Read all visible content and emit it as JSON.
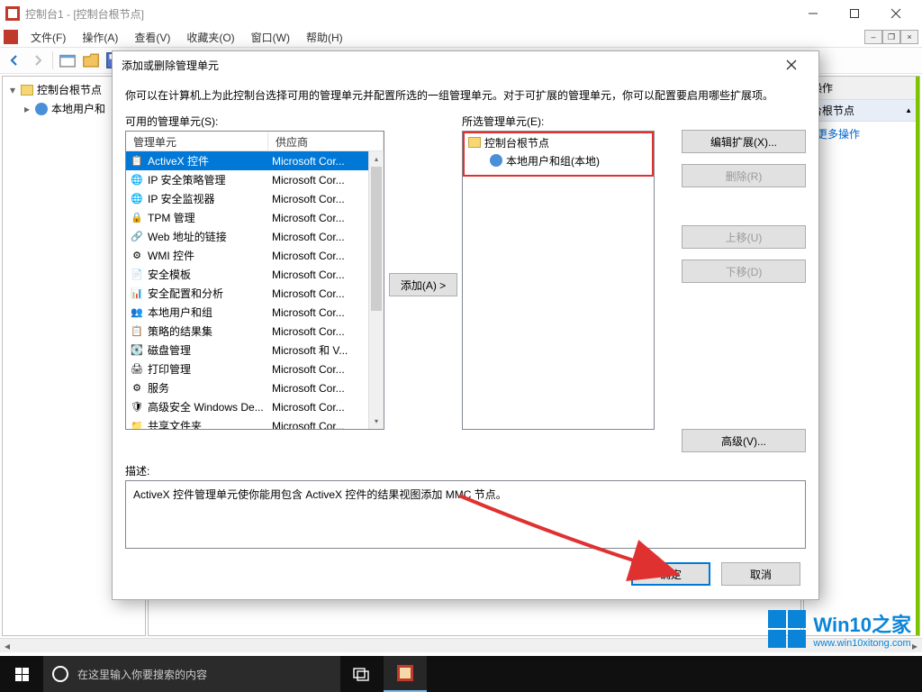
{
  "main_window": {
    "title": "控制台1 - [控制台根节点]",
    "menu": [
      "文件(F)",
      "操作(A)",
      "查看(V)",
      "收藏夹(O)",
      "窗口(W)",
      "帮助(H)"
    ],
    "tree": {
      "root": "控制台根节点",
      "child": "本地用户和"
    },
    "actions_pane": {
      "header": "操作",
      "section": "台根节点",
      "more": "更多操作"
    }
  },
  "dialog": {
    "title": "添加或删除管理单元",
    "intro": "你可以在计算机上为此控制台选择可用的管理单元并配置所选的一组管理单元。对于可扩展的管理单元，你可以配置要启用哪些扩展项。",
    "available_label": "可用的管理单元(S):",
    "selected_label": "所选管理单元(E):",
    "columns": {
      "snapin": "管理单元",
      "vendor": "供应商"
    },
    "available": [
      {
        "name": "ActiveX 控件",
        "vendor": "Microsoft Cor...",
        "icon": "📋",
        "selected": true
      },
      {
        "name": "IP 安全策略管理",
        "vendor": "Microsoft Cor...",
        "icon": "🌐"
      },
      {
        "name": "IP 安全监视器",
        "vendor": "Microsoft Cor...",
        "icon": "🌐"
      },
      {
        "name": "TPM 管理",
        "vendor": "Microsoft Cor...",
        "icon": "🔒"
      },
      {
        "name": "Web 地址的链接",
        "vendor": "Microsoft Cor...",
        "icon": "🔗"
      },
      {
        "name": "WMI 控件",
        "vendor": "Microsoft Cor...",
        "icon": "⚙"
      },
      {
        "name": "安全模板",
        "vendor": "Microsoft Cor...",
        "icon": "📄"
      },
      {
        "name": "安全配置和分析",
        "vendor": "Microsoft Cor...",
        "icon": "📊"
      },
      {
        "name": "本地用户和组",
        "vendor": "Microsoft Cor...",
        "icon": "👥"
      },
      {
        "name": "策略的结果集",
        "vendor": "Microsoft Cor...",
        "icon": "📋"
      },
      {
        "name": "磁盘管理",
        "vendor": "Microsoft 和 V...",
        "icon": "💽"
      },
      {
        "name": "打印管理",
        "vendor": "Microsoft Cor...",
        "icon": "🖨"
      },
      {
        "name": "服务",
        "vendor": "Microsoft Cor...",
        "icon": "⚙"
      },
      {
        "name": "高级安全 Windows De...",
        "vendor": "Microsoft Cor...",
        "icon": "🛡"
      },
      {
        "name": "共享文件夹",
        "vendor": "Microsoft Cor...",
        "icon": "📁"
      }
    ],
    "selected_tree": {
      "root": "控制台根节点",
      "child": "本地用户和组(本地)"
    },
    "buttons": {
      "add": "添加(A)  >",
      "edit_ext": "编辑扩展(X)...",
      "remove": "删除(R)",
      "move_up": "上移(U)",
      "move_down": "下移(D)",
      "advanced": "高级(V)...",
      "ok": "确定",
      "cancel": "取消"
    },
    "desc_label": "描述:",
    "description": "ActiveX 控件管理单元使你能用包含 ActiveX 控件的结果视图添加 MMC 节点。"
  },
  "taskbar": {
    "search_placeholder": "在这里输入你要搜索的内容"
  },
  "watermark": {
    "brand": "Win10之家",
    "url": "www.win10xitong.com"
  }
}
